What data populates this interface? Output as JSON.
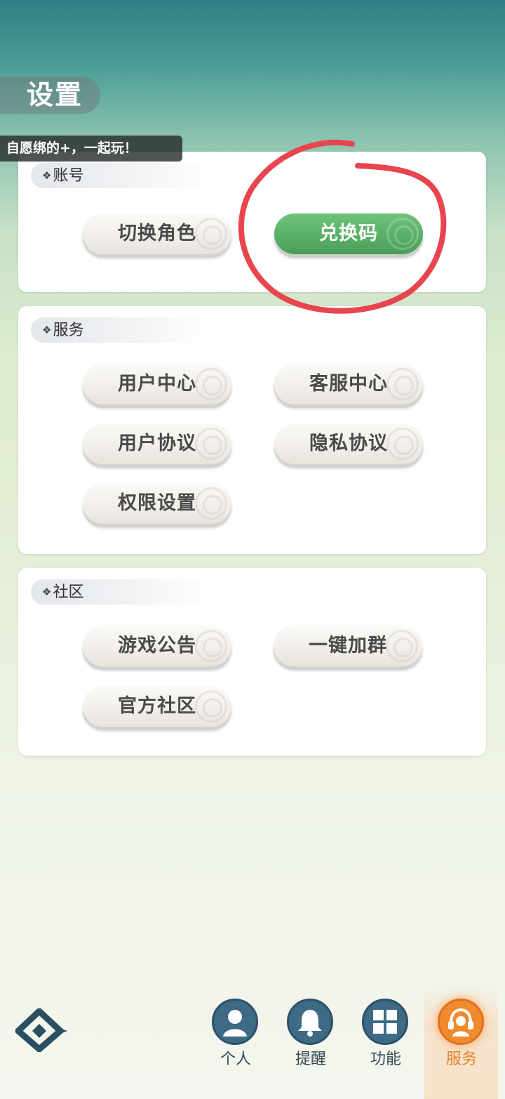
{
  "header": {
    "title": "设置"
  },
  "marquee": {
    "text": "，自愿绑的+，一起玩！"
  },
  "sections": [
    {
      "header": "账号",
      "buttons": [
        {
          "label": "切换角色"
        },
        {
          "label": "兑换码",
          "highlighted": true
        }
      ]
    },
    {
      "header": "服务",
      "buttons": [
        {
          "label": "用户中心"
        },
        {
          "label": "客服中心"
        },
        {
          "label": "用户协议"
        },
        {
          "label": "隐私协议"
        },
        {
          "label": "权限设置"
        }
      ]
    },
    {
      "header": "社区",
      "buttons": [
        {
          "label": "游戏公告"
        },
        {
          "label": "一键加群"
        },
        {
          "label": "官方社区"
        }
      ]
    }
  ],
  "bottom_nav": {
    "items": [
      {
        "label": "个人",
        "icon": "person-icon"
      },
      {
        "label": "提醒",
        "icon": "bell-icon"
      },
      {
        "label": "功能",
        "icon": "grid-icon"
      },
      {
        "label": "服务",
        "icon": "headset-icon",
        "active": true
      }
    ]
  },
  "colors": {
    "accent_green": "#58ae66",
    "active_orange": "#f08a2e",
    "annotation_red": "#e8454e",
    "nav_icon_blue": "#3e6a86"
  }
}
